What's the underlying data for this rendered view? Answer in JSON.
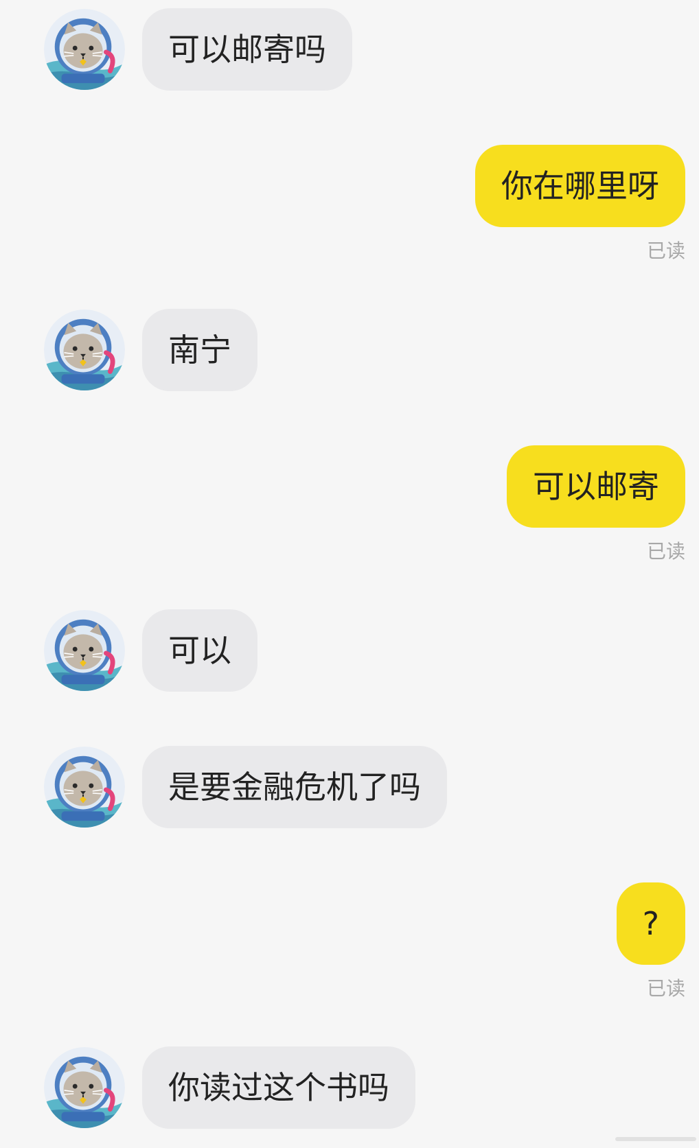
{
  "conversation": {
    "messages": [
      {
        "sender": "other",
        "text": "可以邮寄吗"
      },
      {
        "sender": "me",
        "text": "你在哪里呀",
        "status": "已读"
      },
      {
        "sender": "other",
        "text": "南宁"
      },
      {
        "sender": "me",
        "text": "可以邮寄",
        "status": "已读"
      },
      {
        "sender": "other",
        "text": "可以"
      },
      {
        "sender": "other",
        "text": "是要金融危机了吗"
      },
      {
        "sender": "me",
        "text": "?",
        "status": "已读"
      },
      {
        "sender": "other",
        "text": "你读过这个书吗"
      }
    ]
  },
  "colors": {
    "background": "#f6f6f6",
    "incoming_bubble": "#e9e9eb",
    "outgoing_bubble": "#f7de1e",
    "read_receipt": "#a8a8a8"
  },
  "icons": {
    "avatar": "cat-astronaut-avatar-icon"
  }
}
